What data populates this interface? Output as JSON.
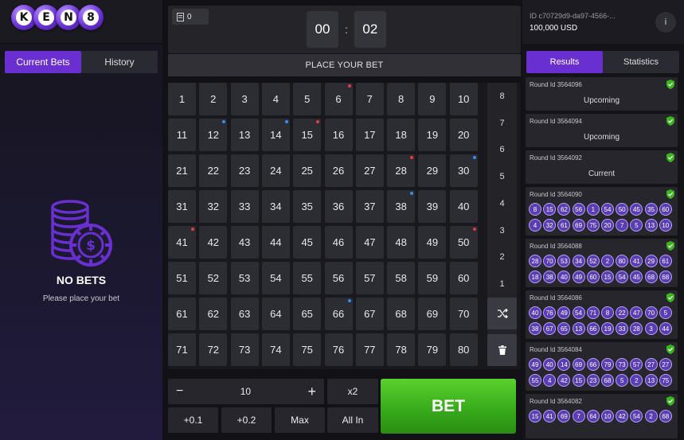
{
  "logo": {
    "letters": [
      "K",
      "E",
      "N",
      "8"
    ]
  },
  "left_tabs": [
    {
      "label": "Current Bets",
      "active": true
    },
    {
      "label": "History",
      "active": false
    }
  ],
  "empty_state": {
    "title": "NO BETS",
    "subtitle": "Please place your bet",
    "icon": "coin-stack-icon"
  },
  "ticket": {
    "count": "0",
    "icon": "ticket-icon"
  },
  "timer": {
    "minutes": "00",
    "separator": ":",
    "seconds": "02"
  },
  "place_bet_label": "PLACE YOUR BET",
  "board": {
    "numbers": [
      "1",
      "2",
      "3",
      "4",
      "5",
      "6",
      "7",
      "8",
      "9",
      "10",
      "11",
      "12",
      "13",
      "14",
      "15",
      "16",
      "17",
      "18",
      "19",
      "20",
      "21",
      "22",
      "23",
      "24",
      "25",
      "26",
      "27",
      "28",
      "29",
      "30",
      "31",
      "32",
      "33",
      "34",
      "35",
      "36",
      "37",
      "38",
      "39",
      "40",
      "41",
      "42",
      "43",
      "44",
      "45",
      "46",
      "47",
      "48",
      "49",
      "50",
      "51",
      "52",
      "53",
      "54",
      "55",
      "56",
      "57",
      "58",
      "59",
      "60",
      "61",
      "62",
      "63",
      "64",
      "65",
      "66",
      "67",
      "68",
      "69",
      "70",
      "71",
      "72",
      "73",
      "74",
      "75",
      "76",
      "77",
      "78",
      "79",
      "80"
    ],
    "red_dots": [
      6,
      15,
      28,
      41,
      50
    ],
    "blue_dots": [
      12,
      14,
      30,
      38,
      66
    ],
    "colors": {
      "red": "#e53b3b",
      "blue": "#2f8ff5"
    }
  },
  "pick_counts": [
    "8",
    "7",
    "6",
    "5",
    "4",
    "3",
    "2",
    "1"
  ],
  "side_buttons": {
    "shuffle_icon": "shuffle-icon",
    "trash_icon": "trash-icon"
  },
  "stake": {
    "minus": "−",
    "value": "10",
    "plus": "+",
    "double": "x2",
    "add_small": "+0.1",
    "add_medium": "+0.2",
    "max": "Max",
    "all_in": "All In"
  },
  "bet_button": {
    "label": "BET",
    "color": "#3cb41e"
  },
  "account": {
    "id": "ID c70729d9-da97-4566-...",
    "balance": "100,000 USD",
    "info_label": "i"
  },
  "right_tabs": [
    {
      "label": "Results",
      "active": true
    },
    {
      "label": "Statistics",
      "active": false
    }
  ],
  "rounds": [
    {
      "id": "Round Id 3564096",
      "status": "Upcoming",
      "numbers": []
    },
    {
      "id": "Round Id 3564094",
      "status": "Upcoming",
      "numbers": []
    },
    {
      "id": "Round Id 3564092",
      "status": "Current",
      "numbers": []
    },
    {
      "id": "Round Id 3564090",
      "status": "",
      "numbers": [
        "8",
        "15",
        "62",
        "56",
        "1",
        "54",
        "50",
        "45",
        "35",
        "60",
        "4",
        "32",
        "61",
        "69",
        "75",
        "20",
        "7",
        "5",
        "13",
        "10"
      ]
    },
    {
      "id": "Round Id 3564088",
      "status": "",
      "numbers": [
        "28",
        "70",
        "53",
        "34",
        "52",
        "2",
        "80",
        "41",
        "29",
        "61",
        "18",
        "38",
        "40",
        "49",
        "60",
        "15",
        "54",
        "45",
        "68",
        "68"
      ]
    },
    {
      "id": "Round Id 3564086",
      "status": "",
      "numbers": [
        "40",
        "76",
        "49",
        "54",
        "71",
        "8",
        "22",
        "47",
        "70",
        "5",
        "38",
        "67",
        "65",
        "13",
        "66",
        "19",
        "33",
        "28",
        "3",
        "44"
      ]
    },
    {
      "id": "Round Id 3564084",
      "status": "",
      "numbers": [
        "49",
        "40",
        "14",
        "69",
        "66",
        "79",
        "73",
        "57",
        "27",
        "27",
        "55",
        "4",
        "42",
        "15",
        "23",
        "68",
        "5",
        "2",
        "13",
        "75"
      ]
    },
    {
      "id": "Round Id 3564082",
      "status": "",
      "numbers": [
        "15",
        "41",
        "69",
        "7",
        "64",
        "10",
        "42",
        "54",
        "2",
        "68"
      ]
    }
  ],
  "accent": "#6a2fd0"
}
